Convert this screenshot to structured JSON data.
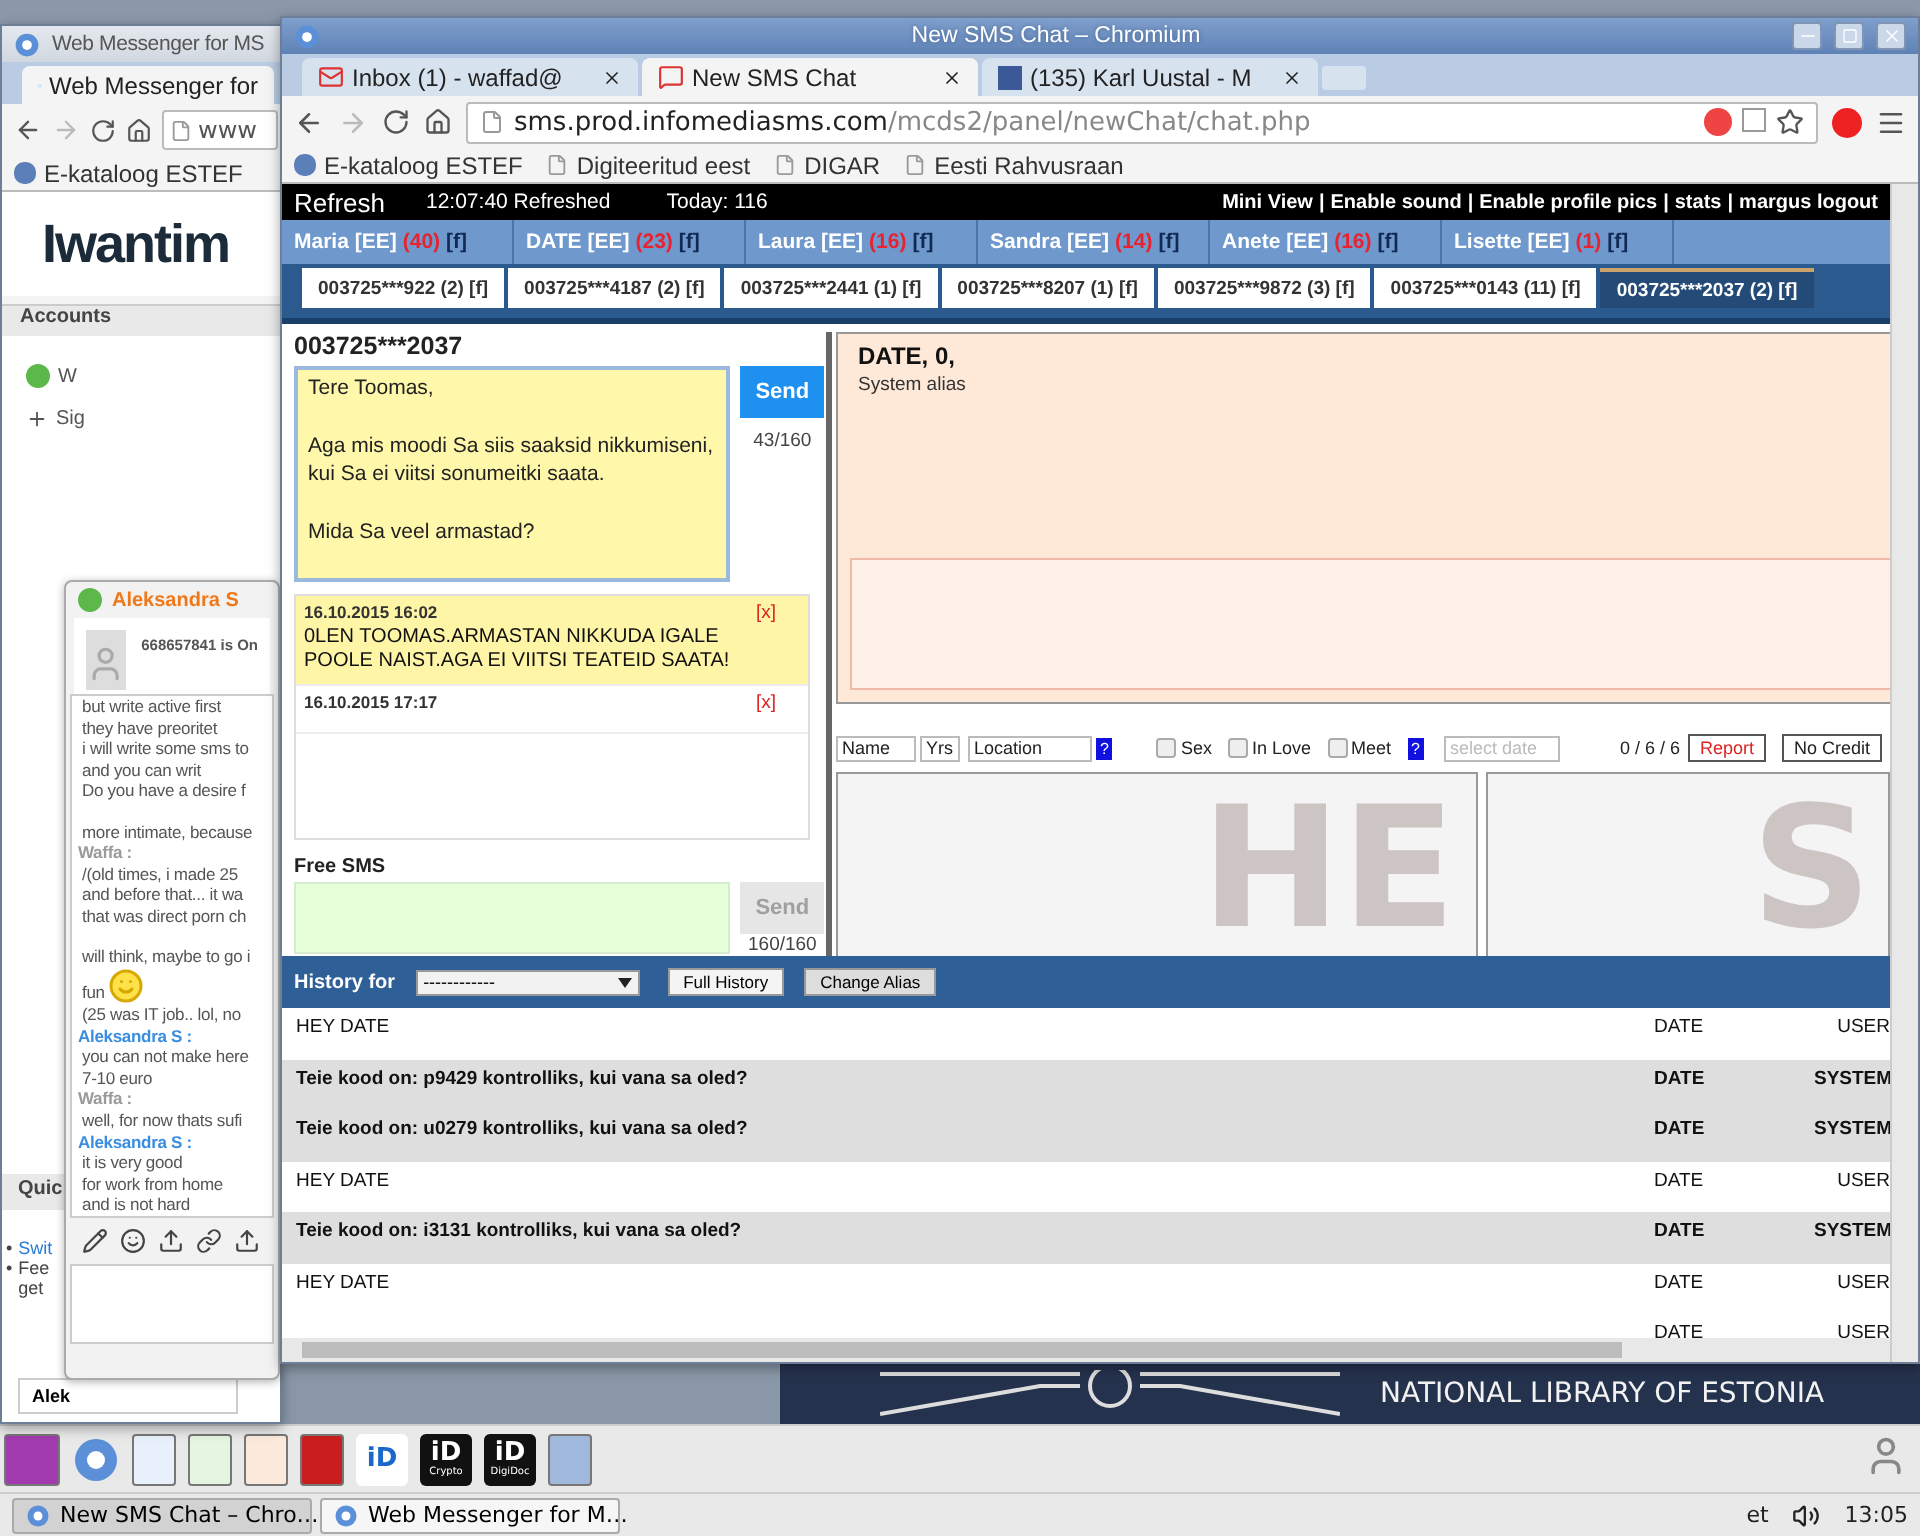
{
  "back_window": {
    "title": "Web Messenger for MS",
    "tab": "Web Messenger for",
    "address": "www",
    "bookmarks": [
      "E-kataloog ESTEF"
    ],
    "logo": "Iwantim",
    "accounts_label": "Accounts",
    "accounts": [
      {
        "kind": "contact",
        "text": "W"
      },
      {
        "kind": "add",
        "text": "Sig"
      }
    ],
    "quick_label": "Quic",
    "quick_items": [
      {
        "kind": "link",
        "bullet": "•",
        "lines": [
          "Swit"
        ]
      },
      {
        "kind": "text",
        "bullet": "•",
        "lines": [
          "Fee",
          "get"
        ]
      }
    ],
    "task": "Alek"
  },
  "chat_popup": {
    "name": "Aleksandra S",
    "status": "668657841 is On",
    "lines": [
      {
        "kind": "message",
        "text": "but write active first"
      },
      {
        "kind": "message",
        "text": "they have preoritet"
      },
      {
        "kind": "message",
        "text": "i will write some sms to"
      },
      {
        "kind": "message",
        "text": "and you can writ"
      },
      {
        "kind": "message",
        "text": "Do you have a desire f"
      },
      {
        "kind": "gap"
      },
      {
        "kind": "message",
        "text": "more intimate, because"
      },
      {
        "kind": "sender",
        "text": "Waffa :",
        "color": "#9a9a9a"
      },
      {
        "kind": "message",
        "text": "/(old times, i made 25"
      },
      {
        "kind": "message",
        "text": "and before that... it wa"
      },
      {
        "kind": "message",
        "text": "that was direct porn ch"
      },
      {
        "kind": "gap"
      },
      {
        "kind": "message",
        "text": "will think, maybe to go i"
      },
      {
        "kind": "emoji",
        "text": "fun"
      },
      {
        "kind": "message",
        "text": "(25 was IT job.. lol, no"
      },
      {
        "kind": "sender",
        "text": "Aleksandra S :",
        "color": "#3a8ee0"
      },
      {
        "kind": "message",
        "text": "you can not make here"
      },
      {
        "kind": "message",
        "text": "7-10 euro"
      },
      {
        "kind": "sender",
        "text": "Waffa :",
        "color": "#9a9a9a"
      },
      {
        "kind": "message",
        "text": "well, for now thats sufi"
      },
      {
        "kind": "sender",
        "text": "Aleksandra S :",
        "color": "#3a8ee0"
      },
      {
        "kind": "message",
        "text": "it is very good"
      },
      {
        "kind": "message",
        "text": "for work from home"
      },
      {
        "kind": "message",
        "text": "and is not hard"
      }
    ]
  },
  "front_window": {
    "title": "New SMS Chat – Chromium",
    "tabs": [
      {
        "label": "Inbox (1) - waffad@",
        "kind": "mail",
        "selected": false
      },
      {
        "label": "New SMS Chat",
        "kind": "sms",
        "selected": true
      },
      {
        "label": "(135) Karl Uustal - M",
        "kind": "social",
        "selected": false
      }
    ],
    "address": {
      "host": "sms.prod.infomediasms.com",
      "path": "/mcds2/panel/newChat/chat.php"
    },
    "bookmarks": [
      {
        "kind": "site",
        "label": "E-kataloog ESTEF"
      },
      {
        "kind": "page",
        "label": "Digiteeritud eest"
      },
      {
        "kind": "page",
        "label": "DIGAR"
      },
      {
        "kind": "page",
        "label": "Eesti Rahvusraan"
      }
    ],
    "page": {
      "refresh": "Refresh",
      "refreshed": "12:07:40 Refreshed",
      "today": "Today: 116",
      "links": [
        "Mini View",
        "Enable sound",
        "Enable profile pics",
        "stats",
        "margus logout"
      ],
      "link_separator": "|",
      "profiles": [
        {
          "name": "Maria [EE]",
          "count": "(40)",
          "flag": "[f]"
        },
        {
          "name": "DATE [EE]",
          "count": "(23)",
          "flag": "[f]"
        },
        {
          "name": "Laura [EE]",
          "count": "(16)",
          "flag": "[f]"
        },
        {
          "name": "Sandra [EE]",
          "count": "(14)",
          "flag": "[f]"
        },
        {
          "name": "Anete [EE]",
          "count": "(16)",
          "flag": "[f]"
        },
        {
          "name": "Lisette [EE]",
          "count": "(1)",
          "flag": "[f]"
        }
      ],
      "numbers": [
        {
          "label": "003725***922 (2) [f]",
          "selected": false
        },
        {
          "label": "003725***4187 (2) [f]",
          "selected": false
        },
        {
          "label": "003725***2441 (1) [f]",
          "selected": false
        },
        {
          "label": "003725***8207 (1) [f]",
          "selected": false
        },
        {
          "label": "003725***9872 (3) [f]",
          "selected": false
        },
        {
          "label": "003725***0143 (11) [f]",
          "selected": false
        },
        {
          "label": "003725***2037 (2) [f]",
          "selected": true
        }
      ],
      "chat": {
        "number": "003725***2037",
        "compose": "Tere Toomas,\n\nAga mis moodi Sa siis saaksid nikkumiseni, kui Sa ei viitsi sonumeitki saata.\n\nMida Sa veel armastad?",
        "send": "Send",
        "counter": "43/160",
        "messages": [
          {
            "date": "16.10.2015 16:02",
            "text": "0LEN TOOMAS.ARMASTAN NIKKUDA IGALE POOLE NAIST.AGA EI VIITSI TEATEID SAATA!",
            "delete": "[x]",
            "highlighted": true
          },
          {
            "date": "16.10.2015 17:17",
            "delete": "[x]",
            "highlighted": false
          }
        ],
        "free_sms": {
          "label": "Free SMS",
          "send": "Send",
          "disabled": true,
          "counter": "160/160"
        }
      },
      "profile": {
        "title": "DATE, 0,",
        "subtitle": "System alias",
        "name": "Name",
        "age": "Yrs",
        "location": "Location",
        "location_help": "?",
        "checks": [
          {
            "label": "Sex",
            "checked": false
          },
          {
            "label": "In Love",
            "checked": false
          },
          {
            "label": "Meet",
            "checked": false
          }
        ],
        "checks_help": "?",
        "date_placeholder": "select date",
        "counter": "0 / 6 / 6",
        "report": "Report",
        "no_credit": "No Credit",
        "notes": [
          {
            "watermark": "HE"
          },
          {
            "watermark": "S"
          }
        ]
      },
      "history": {
        "label": "History for",
        "select": "------------",
        "full": "Full History",
        "alias": "Change Alias",
        "rows": [
          {
            "text": "HEY DATE",
            "date": "DATE",
            "user": "USER",
            "system": false
          },
          {
            "text": "Teie kood on: p9429 kontrolliks, kui vana sa oled?",
            "date": "DATE",
            "user": "SYSTEM",
            "system": true
          },
          {
            "text": "Teie kood on: u0279 kontrolliks, kui vana sa oled?",
            "date": "DATE",
            "user": "SYSTEM",
            "system": true
          },
          {
            "text": "HEY DATE",
            "date": "DATE",
            "user": "USER",
            "system": false
          },
          {
            "text": "Teie kood on: i3131 kontrolliks, kui vana sa oled?",
            "date": "DATE",
            "user": "SYSTEM",
            "system": true
          },
          {
            "text": "HEY DATE",
            "date": "DATE",
            "user": "USER",
            "system": false
          },
          {
            "date": "DATE",
            "user": "USER",
            "system": false
          }
        ]
      }
    }
  },
  "banner": {
    "text": "NATIONAL LIBRARY OF ESTONIA"
  },
  "panel": {
    "launchers": [
      {
        "kind": "desktop"
      },
      {
        "kind": "browser"
      },
      {
        "kind": "writer"
      },
      {
        "kind": "calc"
      },
      {
        "kind": "impress"
      },
      {
        "kind": "pdf"
      },
      {
        "kind": "id",
        "label": "iD"
      },
      {
        "kind": "id",
        "label": "iD",
        "caption": "Crypto"
      },
      {
        "kind": "id",
        "label": "iD",
        "caption": "DigiDoc"
      },
      {
        "kind": "calculator"
      }
    ]
  },
  "taskbar": {
    "tasks": [
      {
        "title": "New SMS Chat – Chro…",
        "selected": true
      },
      {
        "title": "Web Messenger for M…",
        "selected": false
      }
    ],
    "keyboard": "et",
    "clock": "13:05"
  }
}
